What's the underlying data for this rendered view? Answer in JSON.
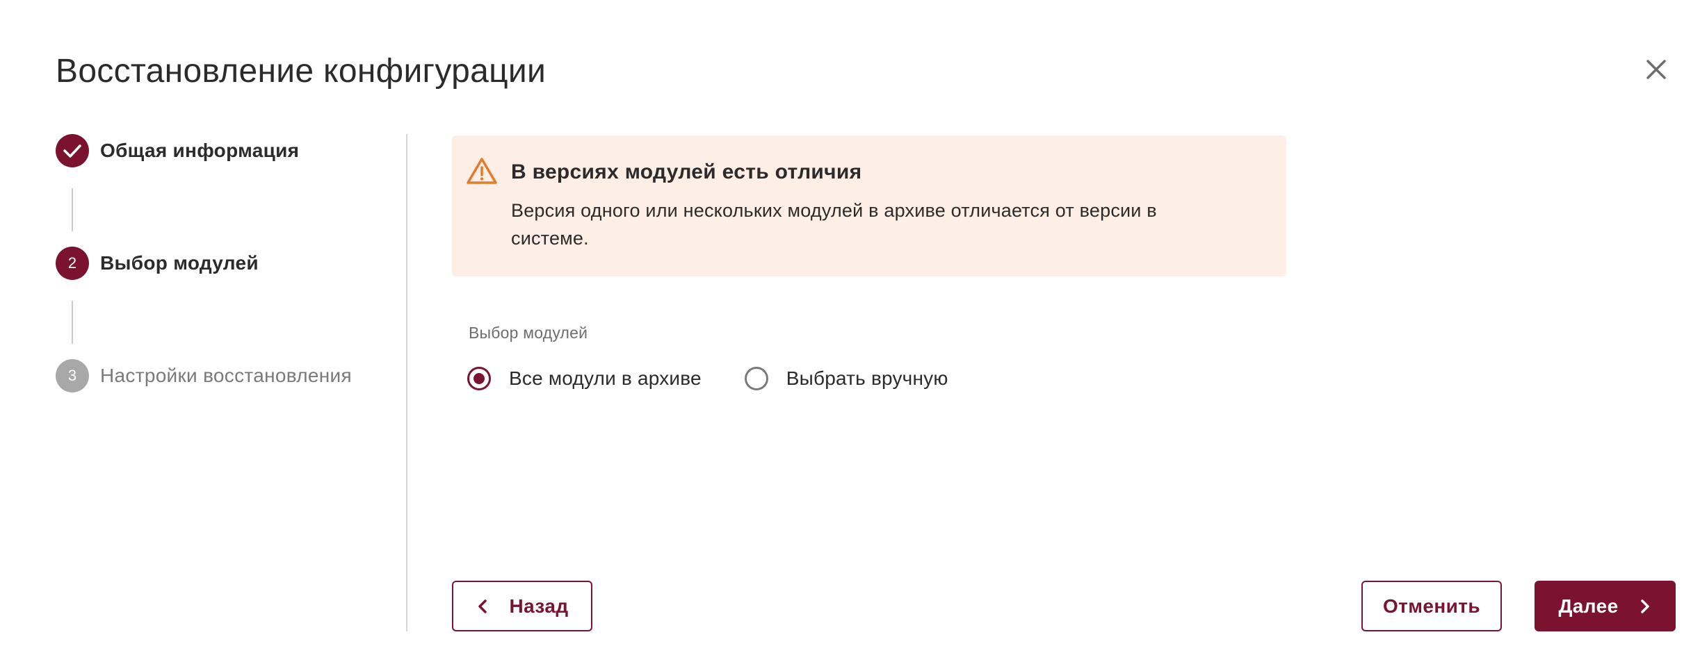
{
  "dialog": {
    "title": "Восстановление конфигурации"
  },
  "stepper": {
    "steps": [
      {
        "number": "1",
        "label": "Общая информация",
        "state": "done"
      },
      {
        "number": "2",
        "label": "Выбор модулей",
        "state": "active"
      },
      {
        "number": "3",
        "label": "Настройки восстановления",
        "state": "pending"
      }
    ]
  },
  "alert": {
    "icon": "warning-triangle-icon",
    "title": "В версиях модулей есть отличия",
    "text": "Версия одного или нескольких модулей в архиве отличается от версии в системе."
  },
  "module_selection": {
    "label": "Выбор модулей",
    "options": [
      {
        "label": "Все модули в архиве",
        "checked": true
      },
      {
        "label": "Выбрать вручную",
        "checked": false
      }
    ]
  },
  "footer": {
    "back_label": "Назад",
    "cancel_label": "Отменить",
    "next_label": "Далее"
  },
  "colors": {
    "accent": "#7b1230",
    "alert_background": "#fdefe6",
    "warning": "#e67a2c",
    "pending_step": "#a8a8a8"
  }
}
